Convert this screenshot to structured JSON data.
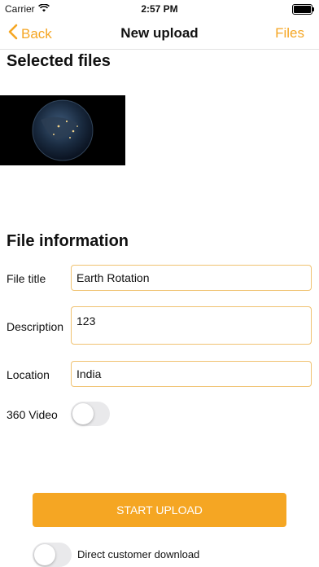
{
  "status_bar": {
    "carrier": "Carrier",
    "time": "2:57 PM"
  },
  "nav": {
    "back_label": "Back",
    "title": "New upload",
    "files_label": "Files"
  },
  "colors": {
    "accent": "#f5a623",
    "field_border": "#f0c271"
  },
  "selected_files": {
    "title": "Selected files"
  },
  "file_information": {
    "title": "File information",
    "file_title_label": "File title",
    "file_title_value": "Earth Rotation",
    "description_label": "Description",
    "description_value": "123",
    "location_label": "Location",
    "location_value": "India",
    "video360_label": "360 Video",
    "video360_on": false
  },
  "actions": {
    "start_upload_label": "START UPLOAD",
    "direct_download_label": "Direct customer download",
    "direct_download_on": false
  }
}
